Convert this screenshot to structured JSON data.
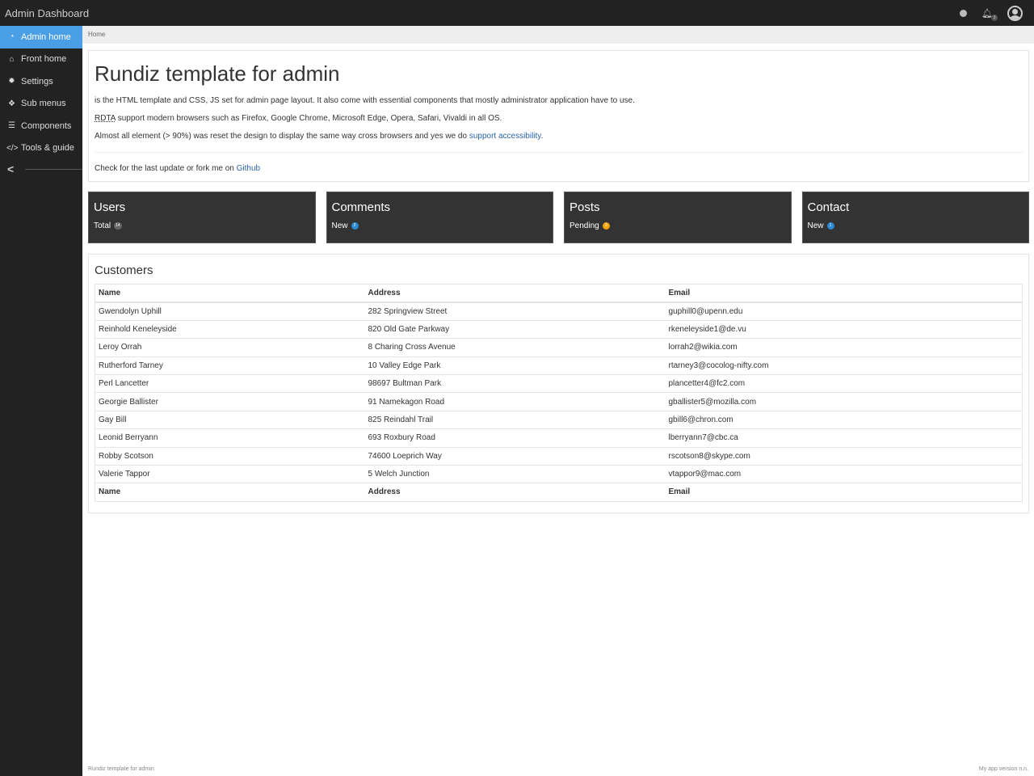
{
  "app": {
    "title": "Admin Dashboard"
  },
  "topbar": {
    "icons": [
      "globe-icon",
      "bell-icon",
      "user-avatar-icon"
    ],
    "notification_count": "3"
  },
  "sidebar": {
    "items": [
      {
        "label": "Admin home",
        "icon": "dashboard-icon",
        "glyph": "◔",
        "active": true
      },
      {
        "label": "Front home",
        "icon": "home-icon",
        "glyph": "⌂",
        "active": false
      },
      {
        "label": "Settings",
        "icon": "gear-icon",
        "glyph": "✹",
        "active": false
      },
      {
        "label": "Sub menus",
        "icon": "cubes-icon",
        "glyph": "❖",
        "active": false
      },
      {
        "label": "Components",
        "icon": "server-icon",
        "glyph": "☰",
        "active": false
      },
      {
        "label": "Tools & guide",
        "icon": "code-icon",
        "glyph": "</>",
        "active": false
      }
    ],
    "collapse_glyph": "<"
  },
  "breadcrumb": {
    "items": [
      "Home"
    ]
  },
  "intro": {
    "title": "Rundiz template for admin",
    "p1": "is the HTML template and CSS, JS set for admin page layout. It also come with essential components that mostly administrator application have to use.",
    "p2_abbr": "RDTA",
    "p2_rest": " support modern browsers such as Firefox, Google Chrome, Microsoft Edge, Opera, Safari, Vivaldi in all OS.",
    "p3_text": "Almost all element (> 90%) was reset the design to display the same way cross browsers and yes we do ",
    "p3_link": "support accessibility",
    "p3_end": ".",
    "p4_text": "Check for the last update or fork me on ",
    "p4_link": "Github"
  },
  "cards": [
    {
      "title": "Users",
      "label": "Total",
      "count": "14",
      "badge_color": "#666666"
    },
    {
      "title": "Comments",
      "label": "New",
      "count": "2",
      "badge_color": "#2b8ad1"
    },
    {
      "title": "Posts",
      "label": "Pending",
      "count": "3",
      "badge_color": "#f0a30a"
    },
    {
      "title": "Contact",
      "label": "New",
      "count": "1",
      "badge_color": "#2b8ad1"
    }
  ],
  "customers": {
    "title": "Customers",
    "columns": [
      "Name",
      "Address",
      "Email"
    ],
    "rows": [
      [
        "Gwendolyn Uphill",
        "282 Springview Street",
        "guphill0@upenn.edu"
      ],
      [
        "Reinhold Keneleyside",
        "820 Old Gate Parkway",
        "rkeneleyside1@de.vu"
      ],
      [
        "Leroy Orrah",
        "8 Charing Cross Avenue",
        "lorrah2@wikia.com"
      ],
      [
        "Rutherford Tarney",
        "10 Valley Edge Park",
        "rtarney3@cocolog-nifty.com"
      ],
      [
        "Perl Lancetter",
        "98697 Bultman Park",
        "plancetter4@fc2.com"
      ],
      [
        "Georgie Ballister",
        "91 Namekagon Road",
        "gballister5@mozilla.com"
      ],
      [
        "Gay Bill",
        "825 Reindahl Trail",
        "gbill6@chron.com"
      ],
      [
        "Leonid Berryann",
        "693 Roxbury Road",
        "lberryann7@cbc.ca"
      ],
      [
        "Robby Scotson",
        "74600 Loeprich Way",
        "rscotson8@skype.com"
      ],
      [
        "Valerie Tappor",
        "5 Welch Junction",
        "vtappor9@mac.com"
      ]
    ]
  },
  "footer": {
    "left": "Rundiz template for admin",
    "right": "My app version n.n."
  }
}
